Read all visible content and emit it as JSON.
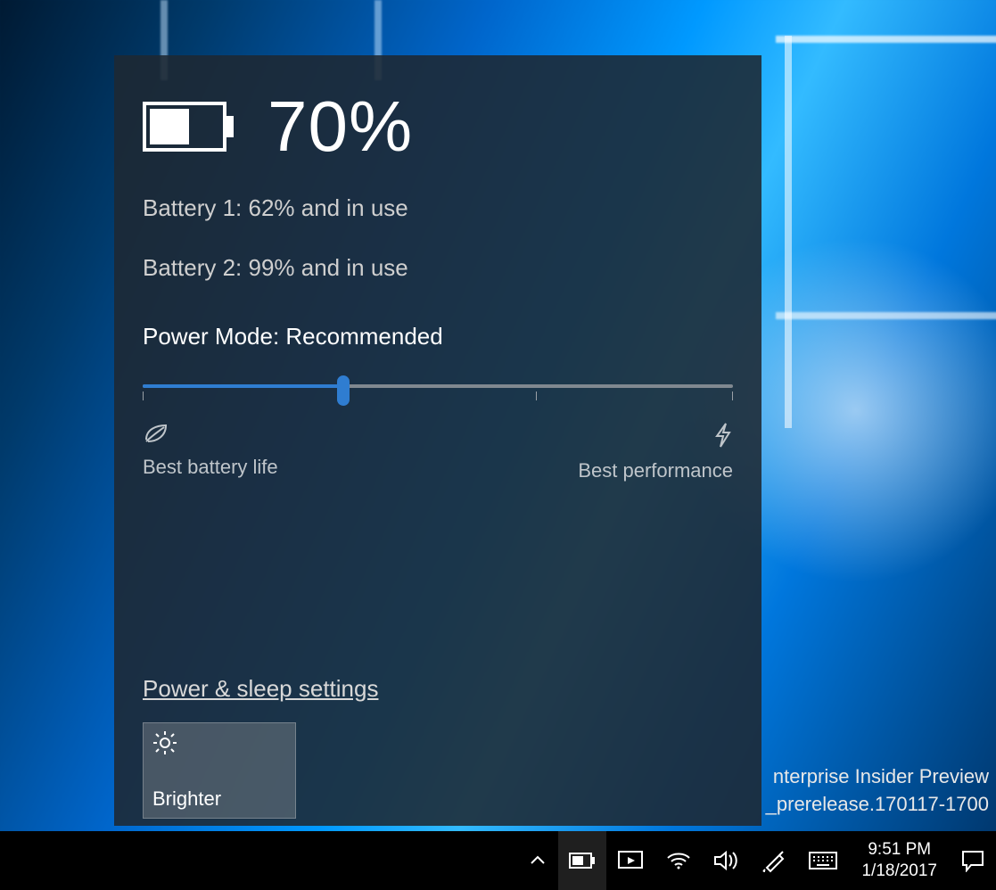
{
  "wallpaper_watermark": {
    "line1": "nterprise Insider Preview",
    "line2": "_prerelease.170117-1700"
  },
  "flyout": {
    "overall_percent": "70%",
    "battery1_text": "Battery 1: 62% and in use",
    "battery2_text": "Battery 2: 99% and in use",
    "power_mode_label": "Power Mode: Recommended",
    "slider": {
      "min_label": "Best battery life",
      "max_label": "Best performance",
      "position_percent": 34,
      "stops": 4
    },
    "settings_link": "Power & sleep settings",
    "brightness_tile_label": "Brighter"
  },
  "taskbar": {
    "chevron_icon": "chevron-up-icon",
    "battery_icon": "battery-icon",
    "project_icon": "project-screen-icon",
    "wifi_icon": "wifi-icon",
    "volume_icon": "volume-icon",
    "pen_icon": "pen-ink-icon",
    "keyboard_icon": "touch-keyboard-icon",
    "action_center_icon": "action-center-icon",
    "clock_time": "9:51 PM",
    "clock_date": "1/18/2017"
  }
}
